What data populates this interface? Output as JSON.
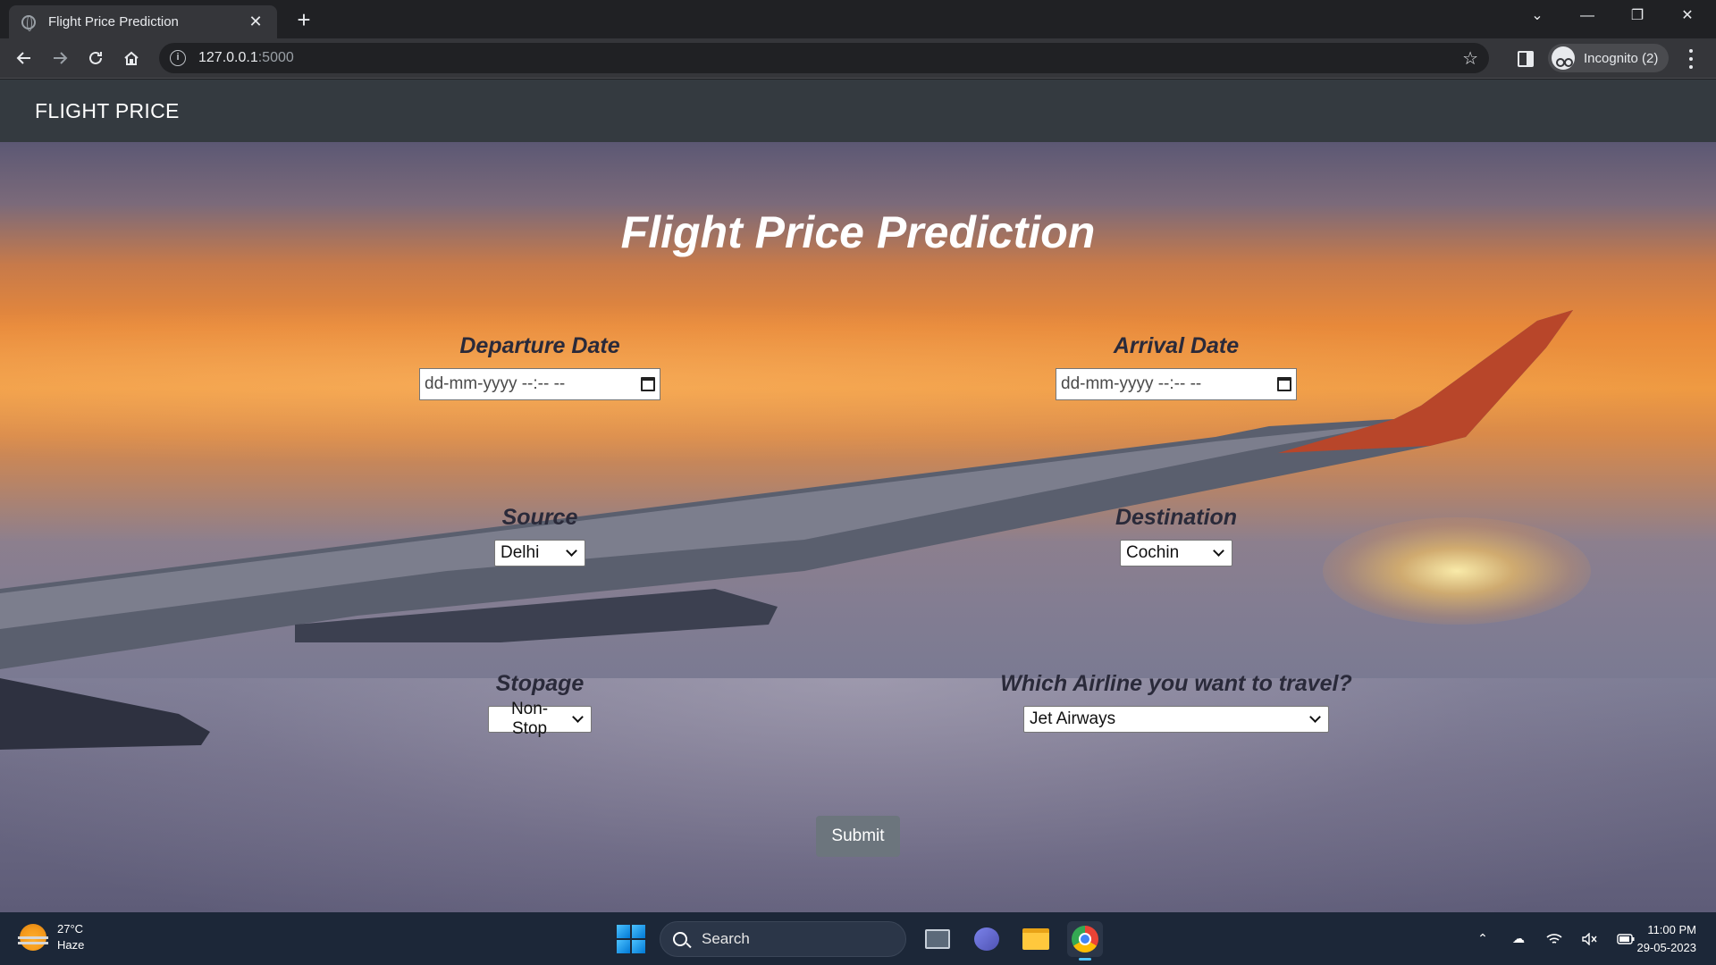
{
  "browser": {
    "tab_title": "Flight Price Prediction",
    "tab_close": "✕",
    "new_tab": "+",
    "url_host": "127.0.0.1",
    "url_port": ":5000",
    "incognito_label": "Incognito (2)",
    "window_controls": {
      "tab_search": "⌄",
      "minimize": "—",
      "restore": "❐",
      "close": "✕"
    }
  },
  "navbar": {
    "brand": "FLIGHT PRICE"
  },
  "form": {
    "title": "Flight Price Prediction",
    "departure": {
      "label": "Departure Date",
      "placeholder": "dd-mm-yyyy --:-- --"
    },
    "arrival": {
      "label": "Arrival Date",
      "placeholder": "dd-mm-yyyy --:-- --"
    },
    "source": {
      "label": "Source",
      "selected": "Delhi"
    },
    "destination": {
      "label": "Destination",
      "selected": "Cochin"
    },
    "stopage": {
      "label": "Stopage",
      "selected": "Non-Stop"
    },
    "airline": {
      "label": "Which Airline you want to travel?",
      "selected": "Jet Airways"
    },
    "submit_label": "Submit"
  },
  "taskbar": {
    "weather_temp": "27°C",
    "weather_cond": "Haze",
    "search_label": "Search",
    "time": "11:00 PM",
    "date": "29-05-2023"
  },
  "colors": {
    "navbar_bg": "#343a40",
    "submit_bg": "#6c757d",
    "browser_bg": "#202124",
    "taskbar_bg": "#1c2738"
  }
}
